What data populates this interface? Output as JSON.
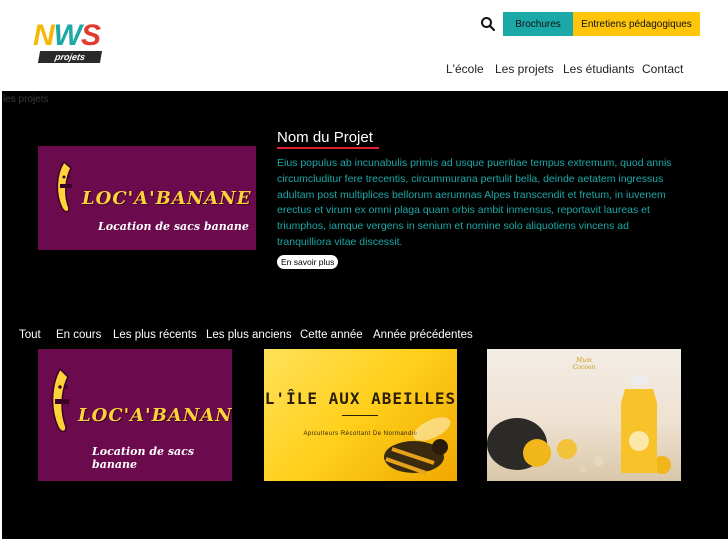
{
  "header": {
    "logo": {
      "word": "NWS",
      "sub": "projets"
    },
    "buttons": {
      "brochures": "Brochures",
      "entretiens": "Entretiens pédagogiques"
    },
    "nav": [
      "L'école",
      "Les projets",
      "Les étudiants",
      "Contact"
    ]
  },
  "breadcrumb": "les projets",
  "featured": {
    "title": "Nom du Projet",
    "description": "Eius populus ab incunabulis primis ad usque pueritiae tempus extremum, quod annis circumcluditur fere trecentis, circummurana pertulit bella, deinde aetatem ingressus adultam post multiplices bellorum aerumnas Alpes transcendit et fretum, in iuvenem erectus et virum ex omni plaga quam orbis ambit inmensus, reportavit laureas et triumphos, iamque vergens in senium et nomine solo aliquotiens vincens ad tranquilliora vitae discessit.",
    "more": "En savoir plus",
    "image": {
      "brand": "LOC'A'BANANE",
      "tagline": "Location de sacs banane"
    }
  },
  "filters": [
    "Tout",
    "En cours",
    "Les plus récents",
    "Les plus anciens",
    "Cette année",
    "Année précédentes"
  ],
  "cards": [
    {
      "brand": "LOC'A'BANANE",
      "tagline": "Location de sacs banane"
    },
    {
      "title": "L'ÎLE AUX ABEILLES",
      "tagline": "Apiculteurs Récoltant De Normandie"
    },
    {
      "brand": "Mum Cocoon"
    }
  ],
  "colors": {
    "teal": "#1aa9a7",
    "yellow": "#ffc50a",
    "purple": "#6b0a4d",
    "red": "#e0202a"
  }
}
